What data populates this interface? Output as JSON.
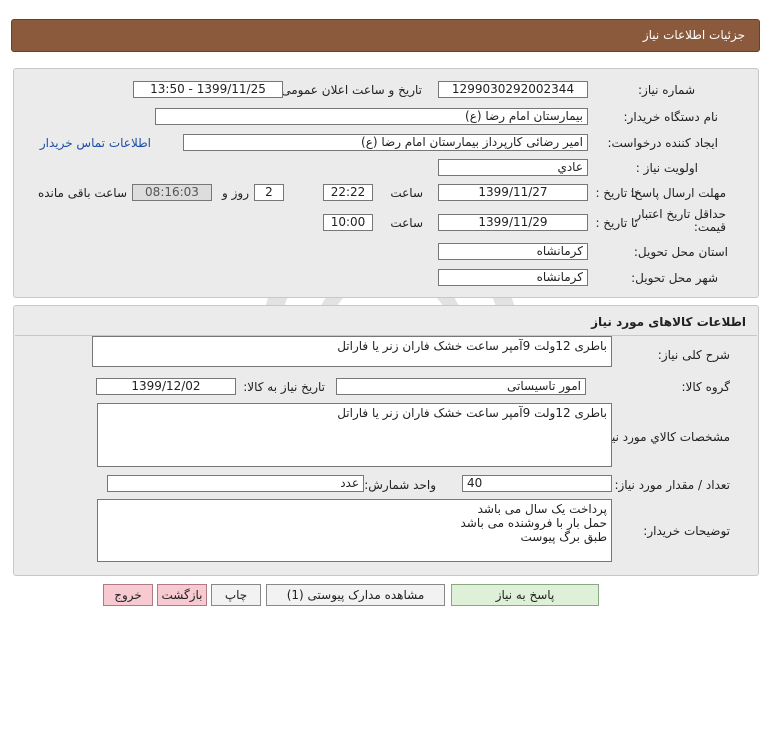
{
  "header": {
    "title": "جزئیات اطلاعات نیاز"
  },
  "info": {
    "need_number_label": "شماره نیاز:",
    "need_number": "1299030292002344",
    "announce_label": "تاریخ و ساعت اعلان عمومی:",
    "announce_value": "1399/11/25 - 13:50",
    "buyer_org_label": "نام دستگاه خریدار:",
    "buyer_org": "بیمارستان امام رضا (ع)",
    "requester_label": "ایجاد کننده درخواست:",
    "requester": "امیر رضائی کارپرداز بیمارستان امام رضا (ع)",
    "contact_link": "اطلاعات تماس خریدار",
    "priority_label": "اولویت نیاز :",
    "priority": "عادي",
    "deadline_label": "مهلت ارسال پاسخ:",
    "until_date_label": "تا تاریخ :",
    "deadline_date": "1399/11/27",
    "time_label": "ساعت",
    "deadline_time": "22:22",
    "days_value": "2",
    "days_label": "روز و",
    "remaining_time": "08:16:03",
    "remaining_label": "ساعت باقی مانده",
    "price_validity_label": "حداقل تاریخ اعتبار قیمت:",
    "validity_until_label": "تا تاریخ :",
    "validity_date": "1399/11/29",
    "validity_time_label": "ساعت",
    "validity_time": "10:00",
    "province_label": "استان محل تحویل:",
    "province": "کرمانشاه",
    "city_label": "شهر محل تحویل:",
    "city": "کرمانشاه"
  },
  "goods": {
    "section_title": "اطلاعات کالاهای مورد نیاز",
    "general_desc_label": "شرح کلی نیاز:",
    "general_desc": "باطری 12ولت 9آمپر ساعت خشک فاران زنر یا فاراتل",
    "group_label": "گروه کالا:",
    "group": "امور تاسیساتی",
    "need_date_label": "تاریخ نیاز به کالا:",
    "need_date": "1399/12/02",
    "specs_label": "مشخصات کالاي مورد نیاز:",
    "specs": "باطری 12ولت 9آمپر ساعت خشک فاران زنر یا فاراتل",
    "quantity_label": "تعداد / مقدار مورد نیاز:",
    "quantity": "40",
    "unit_label": "واحد شمارش:",
    "unit": "عدد",
    "buyer_notes_label": "توضیحات خریدار:",
    "buyer_notes": "پرداخت یک سال می باشد\nحمل بار با فروشنده می باشد\nطبق برگ پیوست"
  },
  "actions": {
    "reply": "پاسخ به نیاز",
    "attachments": "مشاهده مدارک پیوستی (1)",
    "print": "چاپ",
    "back": "بازگشت",
    "exit": "خروج"
  },
  "colors": {
    "header_bg": "#8b5a3c",
    "panel_bg": "#ebebeb",
    "link": "#1a4fa8",
    "pink_button": "#f7c9d0"
  }
}
